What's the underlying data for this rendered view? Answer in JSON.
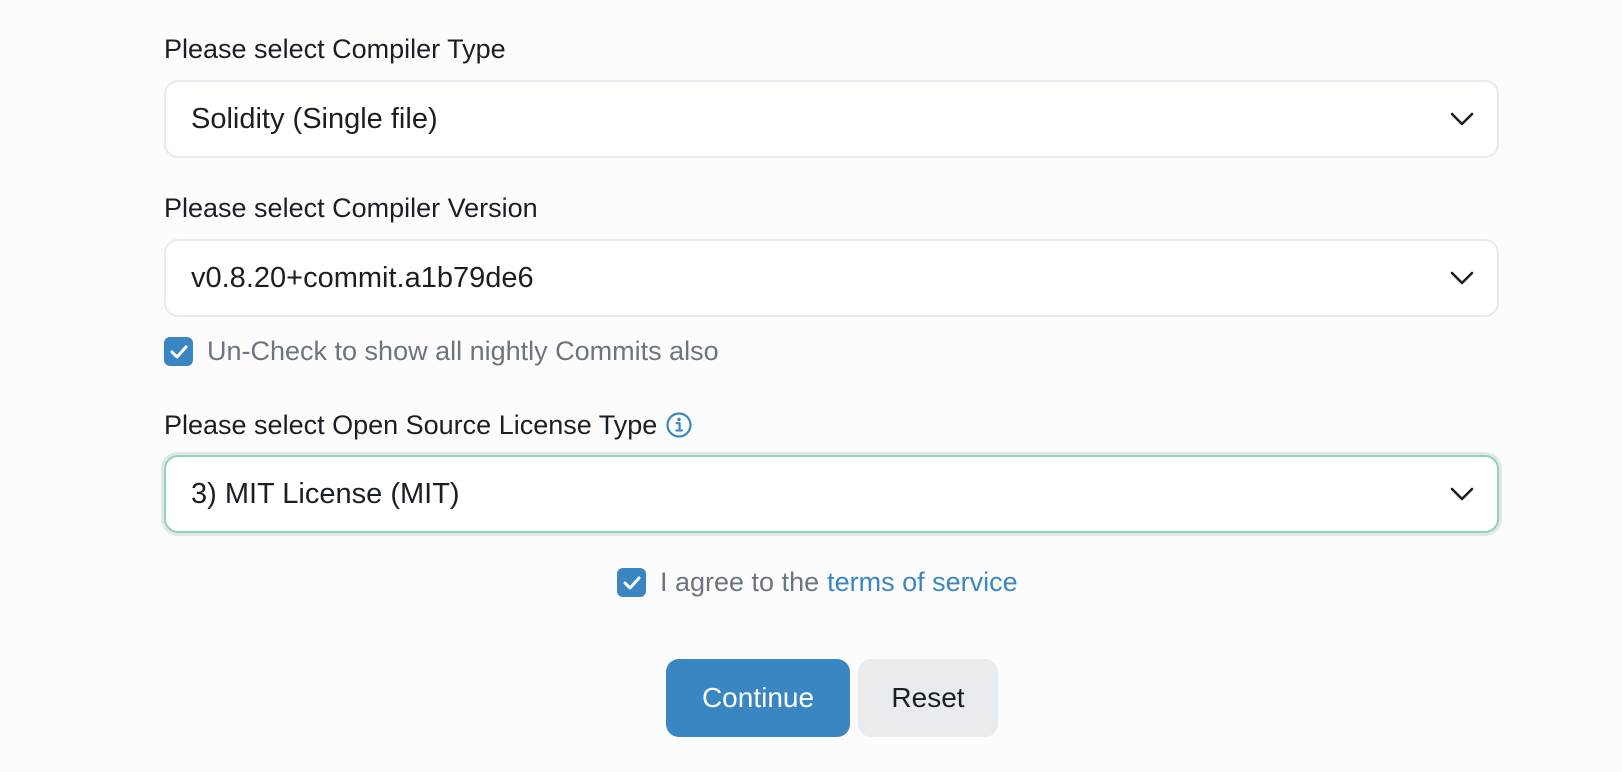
{
  "compiler_type": {
    "label": "Please select Compiler Type",
    "selected": "Solidity (Single file)"
  },
  "compiler_version": {
    "label": "Please select Compiler Version",
    "selected": "v0.8.20+commit.a1b79de6"
  },
  "nightly_commits": {
    "label": "Un-Check to show all nightly Commits also",
    "checked": true
  },
  "license": {
    "label": "Please select Open Source License Type",
    "selected": "3) MIT License (MIT)",
    "info_icon": "info-circle-icon"
  },
  "terms": {
    "prefix": "I agree to the",
    "link_text": "terms of service",
    "checked": true
  },
  "buttons": {
    "continue_label": "Continue",
    "reset_label": "Reset"
  },
  "colors": {
    "accent": "#3a86c2",
    "focus_border": "#8fd3be",
    "muted_text": "#6c757d",
    "secondary_button": "#e9ecef"
  }
}
